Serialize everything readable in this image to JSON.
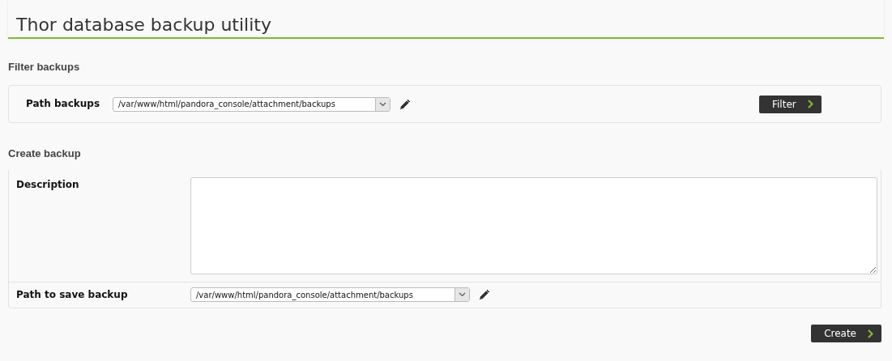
{
  "title": "Thor database backup utility",
  "filter_section": {
    "heading": "Filter backups",
    "path_label": "Path backups",
    "path_value": "/var/www/html/pandora_console/attachment/backups",
    "button": "Filter"
  },
  "create_section": {
    "heading": "Create backup",
    "description_label": "Description",
    "path_label": "Path to save backup",
    "path_value": "/var/www/html/pandora_console/attachment/backups",
    "button": "Create"
  }
}
